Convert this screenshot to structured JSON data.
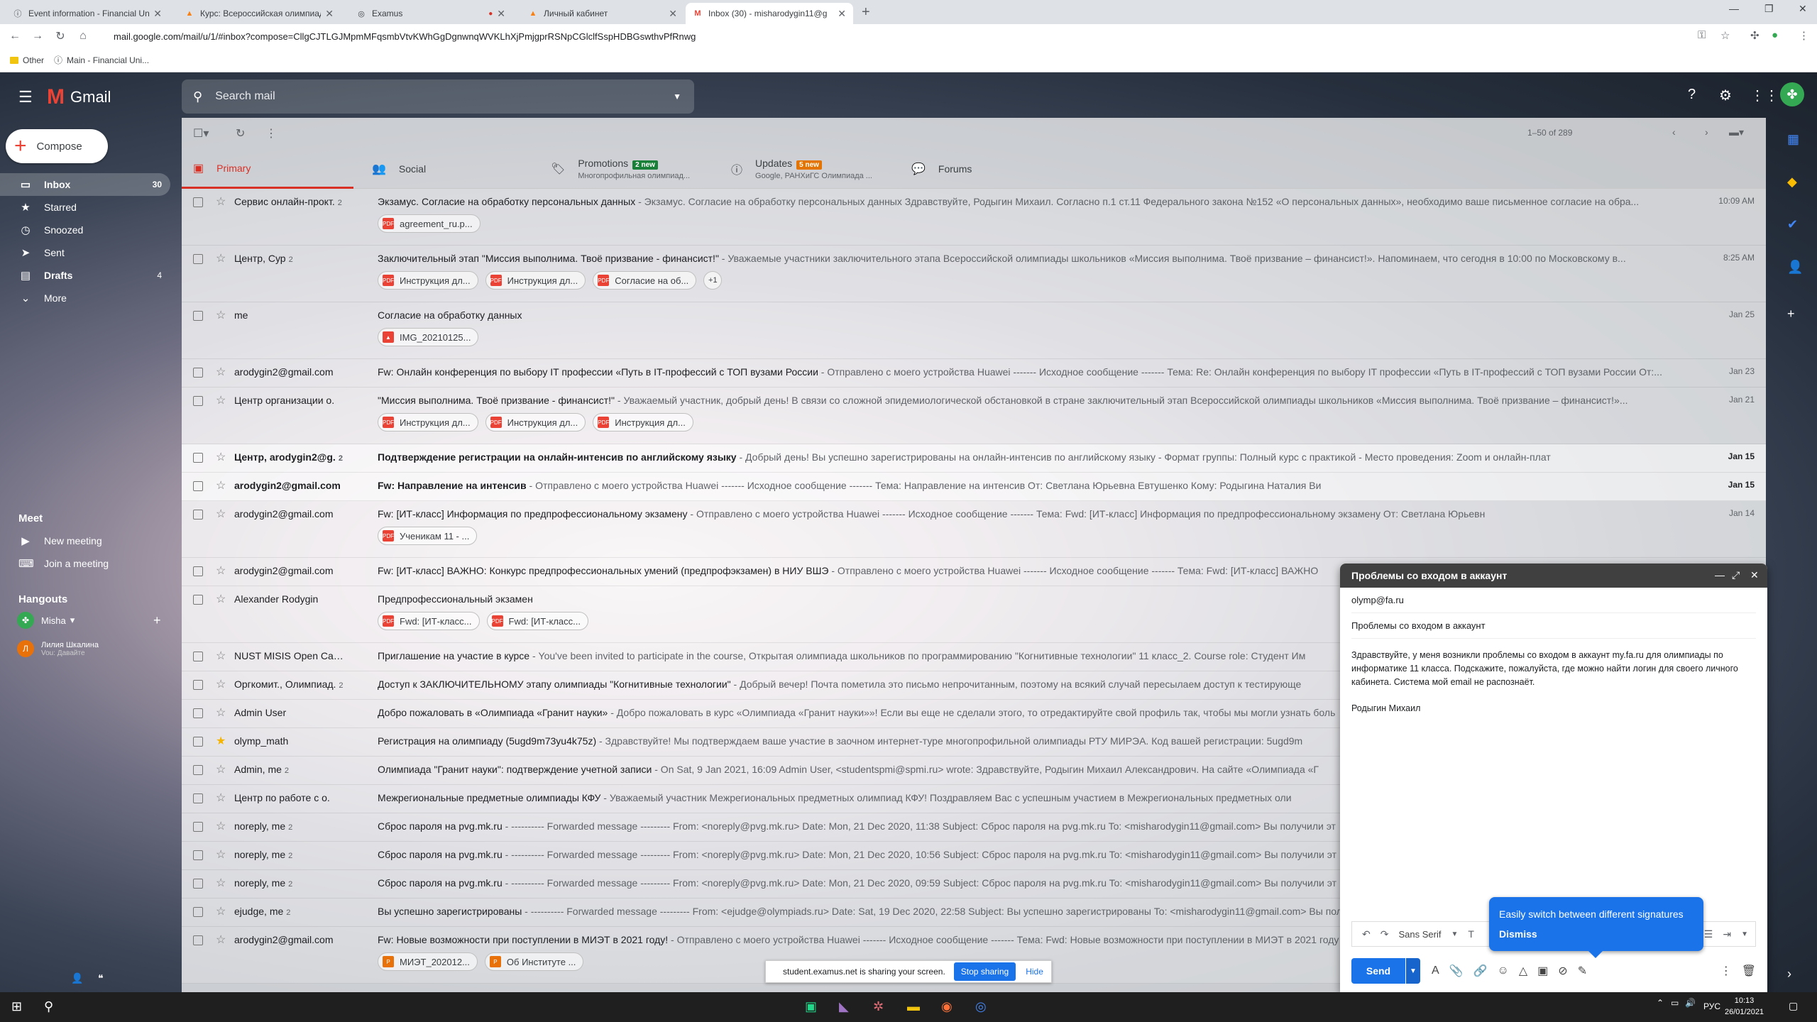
{
  "browser": {
    "tabs": [
      {
        "title": "Event information - Financial Uni",
        "icon": "info-icon"
      },
      {
        "title": "Курс: Всероссийская олимпиад",
        "icon": "moodle-icon"
      },
      {
        "title": "Examus",
        "icon": "globe-icon"
      },
      {
        "title": "Личный кабинет",
        "icon": "moodle-icon"
      },
      {
        "title": "Inbox (30) - misharodygin11@g",
        "icon": "gmail-icon"
      }
    ],
    "url": "mail.google.com/mail/u/1/#inbox?compose=CllgCJTLGJMpmMFqsmbVtvKWhGgDgnwnqWVKLhXjPmjgprRSNpCGlclfSspHDBGswthvPfRnwg",
    "bookmarks": [
      "Other",
      "Main - Financial Uni..."
    ]
  },
  "gmail": {
    "logo_text": "Gmail",
    "search_placeholder": "Search mail",
    "compose_label": "Compose",
    "nav": [
      {
        "label": "Inbox",
        "count": "30",
        "icon": "inbox-icon"
      },
      {
        "label": "Starred",
        "count": "",
        "icon": "star-icon"
      },
      {
        "label": "Snoozed",
        "count": "",
        "icon": "clock-icon"
      },
      {
        "label": "Sent",
        "count": "",
        "icon": "send-icon"
      },
      {
        "label": "Drafts",
        "count": "4",
        "icon": "draft-icon"
      },
      {
        "label": "More",
        "count": "",
        "icon": "chevron-down-icon"
      }
    ],
    "meet": {
      "title": "Meet",
      "new_meeting": "New meeting",
      "join_meeting": "Join a meeting"
    },
    "hangouts": {
      "title": "Hangouts",
      "user": "Misha",
      "contact_name": "Лилия Шкалина",
      "contact_status": "Vou: Давайте"
    },
    "page_count": "1–50 of 289",
    "categories": [
      {
        "label": "Primary",
        "badge": "",
        "sub": ""
      },
      {
        "label": "Social",
        "badge": "",
        "sub": ""
      },
      {
        "label": "Promotions",
        "badge": "2 new",
        "sub": "Многопрофильная олимпиад..."
      },
      {
        "label": "Updates",
        "badge": "5 new",
        "sub": "Google, РАНХиГС Олимпиада ..."
      },
      {
        "label": "Forums",
        "badge": "",
        "sub": ""
      }
    ],
    "emails": [
      {
        "sender": "Сервис онлайн-прокт.",
        "count": "2",
        "subject": "Экзамус. Согласие на обработку персональных данных",
        "snippet": " - Экзамус. Согласие на обработку персональных данных Здравствуйте, Родыгин Михаил. Согласно п.1 ст.11 Федерального закона №152 «О персональных данных», необходимо ваше письменное согласие на обра...",
        "date": "10:09 AM",
        "unread": false,
        "starred": false,
        "chips": [
          "agreement_ru.p..."
        ]
      },
      {
        "sender": "Центр, Сур",
        "count": "2",
        "subject": "Заключительный этап \"Миссия выполнима. Твоё призвание - финансист!\"",
        "snippet": " - Уважаемые участники заключительного этапа Всероссийской олимпиады школьников «Миссия выполнима. Твоё призвание – финансист!». Напоминаем, что сегодня в 10:00 по Московскому в...",
        "date": "8:25 AM",
        "unread": false,
        "starred": false,
        "chips": [
          "Инструкция дл...",
          "Инструкция дл...",
          "Согласие на об..."
        ],
        "more": "+1"
      },
      {
        "sender": "me",
        "count": "",
        "subject": "Согласие на обработку данных",
        "snippet": "",
        "date": "Jan 25",
        "unread": false,
        "starred": false,
        "chips": [
          "IMG_20210125..."
        ]
      },
      {
        "sender": "arodygin2@gmail.com",
        "count": "",
        "subject": "Fw: Онлайн конференция по выбору IT профессии «Путь в IT-профессий с ТОП вузами России",
        "snippet": " - Отправлено с моего устройства Huawei ------- Исходное сообщение ------- Тема: Re: Онлайн конференция по выбору IT профессии «Путь в IT-профессий с ТОП вузами России От:...",
        "date": "Jan 23",
        "unread": false,
        "starred": false,
        "chips": []
      },
      {
        "sender": "Центр организации о.",
        "count": "",
        "subject": "\"Миссия выполнима. Твоё призвание - финансист!\"",
        "snippet": " - Уважаемый участник, добрый день! В связи со сложной эпидемиологической обстановкой в стране заключительный этап Всероссийской олимпиады школьников «Миссия выполнима. Твоё призвание – финансист!»...",
        "date": "Jan 21",
        "unread": false,
        "starred": false,
        "chips": [
          "Инструкция дл...",
          "Инструкция дл...",
          "Инструкция дл..."
        ]
      },
      {
        "sender": "Центр, arodygin2@g.",
        "count": "2",
        "subject": "Подтверждение регистрации на онлайн-интенсив по английскому языку",
        "snippet": " - Добрый день! Вы успешно зарегистрированы на онлайн-интенсив по английскому языку - Формат группы: Полный курс с практикой - Место проведения: Zoom и онлайн-плат",
        "date": "Jan 15",
        "unread": true,
        "starred": false,
        "chips": []
      },
      {
        "sender": "arodygin2@gmail.com",
        "count": "",
        "subject": "Fw: Направление на интенсив",
        "snippet": " - Отправлено с моего устройства Huawei ------- Исходное сообщение ------- Тема: Направление на интенсив От: Светлана Юрьевна Евтушенко Кому: Родыгина Наталия Ви",
        "date": "Jan 15",
        "unread": true,
        "starred": false,
        "chips": []
      },
      {
        "sender": "arodygin2@gmail.com",
        "count": "",
        "subject": "Fw: [ИТ-класс] Информация по предпрофессиональному экзамену",
        "snippet": " - Отправлено с моего устройства Huawei ------- Исходное сообщение ------- Тема: Fwd: [ИТ-класс] Информация по предпрофессиональному экзамену От: Светлана Юрьевн",
        "date": "Jan 14",
        "unread": false,
        "starred": false,
        "chips": [
          "Ученикам 11 - ..."
        ]
      },
      {
        "sender": "arodygin2@gmail.com",
        "count": "",
        "subject": "Fw: [ИТ-класс] ВАЖНО: Конкурс предпрофессиональных умений (предпрофэкзамен) в НИУ ВШЭ",
        "snippet": " - Отправлено с моего устройства Huawei ------- Исходное сообщение ------- Тема: Fwd: [ИТ-класс] ВАЖНО",
        "date": "",
        "unread": false,
        "starred": false,
        "chips": []
      },
      {
        "sender": "Alexander Rodygin",
        "count": "",
        "subject": "Предпрофессиональный экзамен",
        "snippet": "",
        "date": "",
        "unread": false,
        "starred": false,
        "chips": [
          "Fwd: [ИТ-класс...",
          "Fwd: [ИТ-класс..."
        ]
      },
      {
        "sender": "NUST MISIS Open Can.",
        "count": "3",
        "subject": "Приглашение на участие в курсе",
        "snippet": " - You've been invited to participate in the course, Открытая олимпиада школьников по программированию \"Когнитивные технологии\" 11 класс_2. Course role: Студент Им",
        "date": "",
        "unread": false,
        "starred": false,
        "chips": []
      },
      {
        "sender": "Оргкомит., Олимпиад.",
        "count": "2",
        "subject": "Доступ к ЗАКЛЮЧИТЕЛЬНОМУ этапу олимпиады \"Когнитивные технологии\"",
        "snippet": " - Добрый вечер! Почта пометила это письмо непрочитанным, поэтому на всякий случай пересылаем доступ к тестирующе",
        "date": "",
        "unread": false,
        "starred": false,
        "chips": []
      },
      {
        "sender": "Admin User",
        "count": "",
        "subject": "Добро пожаловать в «Олимпиада «Гранит науки»",
        "snippet": " - Добро пожаловать в курс «Олимпиада «Гранит науки»»! Если вы еще не сделали этого, то отредактируйте свой профиль так, чтобы мы могли узнать боль",
        "date": "",
        "unread": false,
        "starred": false,
        "chips": []
      },
      {
        "sender": "olymp_math",
        "count": "",
        "subject": "Регистрация на олимпиаду (5ugd9m73yu4k75z)",
        "snippet": " - Здравствуйте! Мы подтверждаем ваше участие в заочном интернет-туре многопрофильной олимпиады РТУ МИРЭА. Код вашей регистрации: 5ugd9m",
        "date": "",
        "unread": false,
        "starred": true,
        "chips": []
      },
      {
        "sender": "Admin, me",
        "count": "2",
        "subject": "Олимпиада \"Гранит науки\": подтверждение учетной записи",
        "snippet": " - On Sat, 9 Jan 2021, 16:09 Admin User, <studentspmi@spmi.ru> wrote: Здравствуйте, Родыгин Михаил Александрович. На сайте «Олимпиада «Г",
        "date": "",
        "unread": false,
        "starred": false,
        "chips": []
      },
      {
        "sender": "Центр по работе с о.",
        "count": "",
        "subject": "Межрегиональные предметные олимпиады КФУ",
        "snippet": " - Уважаемый участник Межрегиональных предметных олимпиад КФУ! Поздравляем Вас с успешным участием в Межрегиональных предметных оли",
        "date": "",
        "unread": false,
        "starred": false,
        "chips": []
      },
      {
        "sender": "noreply, me",
        "count": "2",
        "subject": "Сброс пароля на pvg.mk.ru",
        "snippet": " - ---------- Forwarded message --------- From: <noreply@pvg.mk.ru> Date: Mon, 21 Dec 2020, 11:38 Subject: Сброс пароля на pvg.mk.ru To: <misharodygin11@gmail.com> Вы получили эт",
        "date": "",
        "unread": false,
        "starred": false,
        "chips": []
      },
      {
        "sender": "noreply, me",
        "count": "2",
        "subject": "Сброс пароля на pvg.mk.ru",
        "snippet": " - ---------- Forwarded message --------- From: <noreply@pvg.mk.ru> Date: Mon, 21 Dec 2020, 10:56 Subject: Сброс пароля на pvg.mk.ru To: <misharodygin11@gmail.com> Вы получили эт",
        "date": "",
        "unread": false,
        "starred": false,
        "chips": []
      },
      {
        "sender": "noreply, me",
        "count": "2",
        "subject": "Сброс пароля на pvg.mk.ru",
        "snippet": " - ---------- Forwarded message --------- From: <noreply@pvg.mk.ru> Date: Mon, 21 Dec 2020, 09:59 Subject: Сброс пароля на pvg.mk.ru To: <misharodygin11@gmail.com> Вы получили эт",
        "date": "",
        "unread": false,
        "starred": false,
        "chips": []
      },
      {
        "sender": "ejudge, me",
        "count": "2",
        "subject": "Вы успешно зарегистрированы",
        "snippet": " - ---------- Forwarded message --------- From: <ejudge@olympiads.ru> Date: Sat, 19 Dec 2020, 22:58 Subject: Вы успешно зарегистрированы To: <misharodygin11@gmail.com> Вы получили",
        "date": "",
        "unread": false,
        "starred": false,
        "chips": []
      },
      {
        "sender": "arodygin2@gmail.com",
        "count": "",
        "subject": "Fw: Новые возможности при поступлении в МИЭТ в 2021 году!",
        "snippet": " - Отправлено с моего устройства Huawei ------- Исходное сообщение ------- Тема: Fwd: Новые возможности при поступлении в МИЭТ в 2021 году",
        "date": "",
        "unread": false,
        "starred": false,
        "chips": [
          "МИЭТ_202012...",
          "Об Институте ..."
        ]
      }
    ],
    "compose_window": {
      "title": "Проблемы со входом в аккаунт",
      "to": "olymp@fa.ru",
      "subject": "Проблемы со входом в аккаунт",
      "body_p1": "Здравствуйте, у меня возникли проблемы со входом в аккаунт my.fa.ru для олимпиады по информатике 11 класса. Подскажите, пожалуйста, где можно найти логин для своего личного кабинета. Система мой email не распознаёт.",
      "body_p2": "Родыгин Михаил",
      "font": "Sans Serif",
      "send_label": "Send"
    },
    "tooltip": {
      "text": "Easily switch between different signatures",
      "dismiss": "Dismiss"
    },
    "share_bar": {
      "text": "student.examus.net is sharing your screen.",
      "stop": "Stop sharing",
      "hide": "Hide"
    }
  },
  "taskbar": {
    "lang": "РУС",
    "time": "10:13",
    "date": "26/01/2021"
  }
}
